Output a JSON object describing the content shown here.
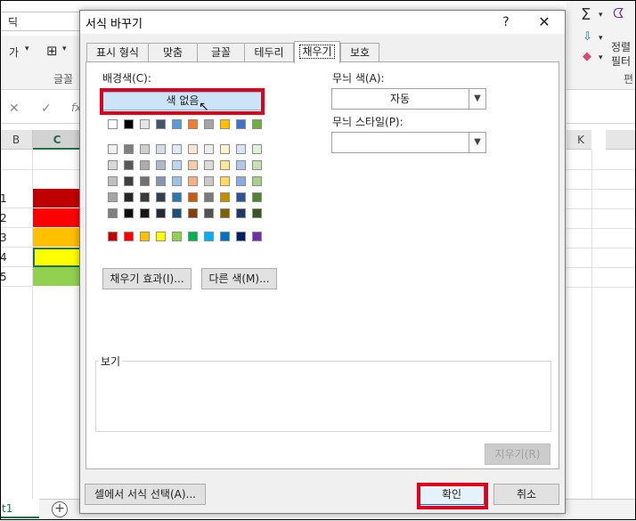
{
  "excel": {
    "name_box": "딕",
    "ribbon_font_frag": "가",
    "ribbon_group_label": "글꼴",
    "ribbon_right_sort": "정렬",
    "ribbon_right_filter": "필터",
    "ribbon_right_group": "편",
    "formula_x": "✕",
    "formula_check": "✓",
    "formula_fx": "fx",
    "col_b": "B",
    "col_c": "C",
    "col_k": "K",
    "rows": [
      "1",
      "2",
      "3",
      "4",
      "5"
    ],
    "cell_colors": [
      "#c00000",
      "#ff0000",
      "#ffc000",
      "#ffff00",
      "#92d050"
    ],
    "sheet_tab": "t1",
    "add_sheet": "+"
  },
  "dialog": {
    "title": "서식 바꾸기",
    "help": "?",
    "close": "✕",
    "tabs": [
      "표시 형식",
      "맞춤",
      "글꼴",
      "테두리",
      "채우기",
      "보호"
    ],
    "active_tab": "채우기",
    "fill": {
      "bg_color_label": "배경색(C):",
      "no_color_button": "색 없음",
      "theme_row_top": [
        "#ffffff",
        "#000000",
        "#e7e6e6",
        "#44546a",
        "#5b9bd5",
        "#ed7d31",
        "#a5a5a5",
        "#ffc000",
        "#4472c4",
        "#70ad47"
      ],
      "theme_shades": [
        [
          "#f2f2f2",
          "#7f7f7f",
          "#d0cece",
          "#d6dce4",
          "#deebf6",
          "#fbe5d5",
          "#ededed",
          "#fff2cc",
          "#dae3f3",
          "#e2efd9"
        ],
        [
          "#d8d8d8",
          "#595959",
          "#aeabab",
          "#adb9ca",
          "#bdd7ee",
          "#f7cbac",
          "#dbdbdb",
          "#fee599",
          "#b4c6e7",
          "#c5e0b3"
        ],
        [
          "#bfbfbf",
          "#3f3f3f",
          "#757070",
          "#8496b0",
          "#9cc3e5",
          "#f4b183",
          "#c9c9c9",
          "#ffd965",
          "#8eaadb",
          "#a8d08d"
        ],
        [
          "#a5a5a5",
          "#262626",
          "#3a3838",
          "#323f4f",
          "#2e75b5",
          "#c55a11",
          "#7b7b7b",
          "#bf9000",
          "#2f5496",
          "#538135"
        ],
        [
          "#7f7f7f",
          "#0c0c0c",
          "#171616",
          "#222a35",
          "#1f4e79",
          "#833c0b",
          "#525252",
          "#7f6000",
          "#1f3864",
          "#375623"
        ]
      ],
      "standard_colors": [
        "#c00000",
        "#ff0000",
        "#ffc000",
        "#ffff00",
        "#92d050",
        "#00b050",
        "#00b0f0",
        "#0070c0",
        "#002060",
        "#7030a0"
      ],
      "fill_effects_button": "채우기 효과(I)...",
      "more_colors_button": "다른 색(M)...",
      "pattern_color_label": "무늬 색(A):",
      "pattern_color_value": "자동",
      "pattern_style_label": "무늬 스타일(P):",
      "pattern_style_value": "",
      "sample_label": "보기",
      "clear_button": "지우기(R)"
    },
    "choose_from_cell_button": "셀에서 서식 선택(A)...",
    "ok_button": "확인",
    "cancel_button": "취소"
  }
}
